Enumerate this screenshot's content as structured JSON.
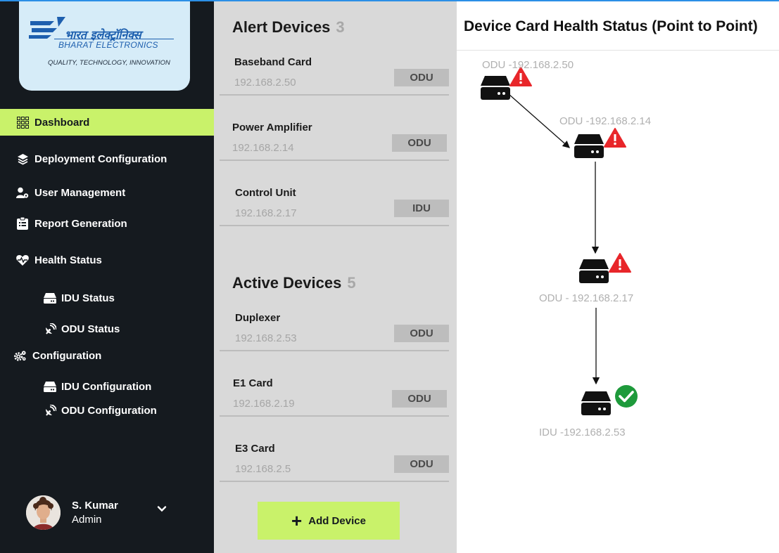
{
  "brand": {
    "hindi": "भारत इलेक्ट्रॉनिक्स",
    "name": "BHARAT ELECTRONICS",
    "tagline": "QUALITY, TECHNOLOGY, INNOVATION"
  },
  "sidebar": {
    "items": [
      {
        "label": "Dashboard",
        "icon": "grid-icon",
        "active": true
      },
      {
        "label": "Deployment Configuration",
        "icon": "layers-icon"
      },
      {
        "label": "User Management",
        "icon": "user-gear-icon"
      },
      {
        "label": "Report Generation",
        "icon": "clipboard-icon"
      },
      {
        "label": "Health Status",
        "icon": "heartbeat-icon"
      },
      {
        "label": "Configuration",
        "icon": "gears-icon"
      }
    ],
    "health_sub": [
      {
        "label": "IDU Status",
        "icon": "server-icon"
      },
      {
        "label": "ODU Status",
        "icon": "satellite-dish-icon"
      }
    ],
    "config_sub": [
      {
        "label": "IDU Configuration",
        "icon": "server-icon"
      },
      {
        "label": "ODU Configuration",
        "icon": "satellite-dish-icon"
      }
    ]
  },
  "user": {
    "name": "S. Kumar",
    "role": "Admin"
  },
  "alert_devices": {
    "title": "Alert Devices",
    "count": "3",
    "items": [
      {
        "name": "Baseband Card",
        "ip": "192.168.2.50",
        "type": "ODU"
      },
      {
        "name": "Power Amplifier",
        "ip": "192.168.2.14",
        "type": "ODU"
      },
      {
        "name": "Control Unit",
        "ip": "192.168.2.17",
        "type": "IDU"
      }
    ]
  },
  "active_devices": {
    "title": "Active Devices",
    "count": "5",
    "items": [
      {
        "name": "Duplexer",
        "ip": "192.168.2.53",
        "type": "ODU"
      },
      {
        "name": "E1 Card",
        "ip": "192.168.2.19",
        "type": "ODU"
      },
      {
        "name": "E3 Card",
        "ip": "192.168.2.5",
        "type": "ODU"
      }
    ]
  },
  "add_device": {
    "label": "Add Device"
  },
  "health_map": {
    "title": "Device Card Health Status (Point to Point)",
    "nodes": [
      {
        "label": "ODU -192.168.2.50",
        "status": "alert"
      },
      {
        "label": "ODU -192.168.2.14",
        "status": "alert"
      },
      {
        "label": "ODU - 192.168.2.17",
        "status": "alert"
      },
      {
        "label": "IDU -192.168.2.53",
        "status": "ok"
      }
    ]
  },
  "colors": {
    "accent": "#c9f26a",
    "sidebar": "#151a1f",
    "alert": "#e8262a",
    "ok": "#1e9a3b"
  }
}
